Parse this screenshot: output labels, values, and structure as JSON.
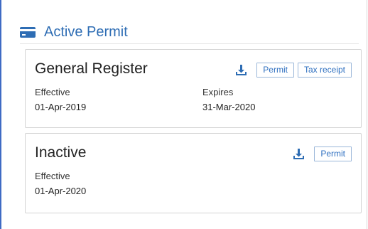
{
  "header": {
    "title": "Active Permit",
    "icon": "credit-card-icon"
  },
  "colors": {
    "accent": "#2e6db4",
    "frame_border": "#3f6bc4",
    "button_border": "#9ab6d9"
  },
  "cards": [
    {
      "title": "General Register",
      "effective_label": "Effective",
      "effective_value": "01-Apr-2019",
      "expires_label": "Expires",
      "expires_value": "31-Mar-2020",
      "download_icon": "download-icon",
      "buttons": {
        "permit": "Permit",
        "tax_receipt": "Tax receipt"
      }
    },
    {
      "title": "Inactive",
      "effective_label": "Effective",
      "effective_value": "01-Apr-2020",
      "download_icon": "download-icon",
      "buttons": {
        "permit": "Permit"
      }
    }
  ]
}
